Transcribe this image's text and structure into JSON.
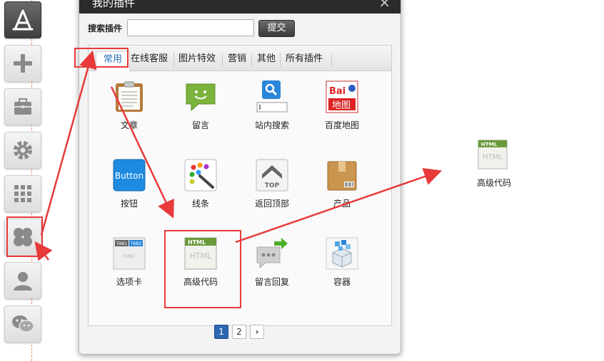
{
  "dialog": {
    "title": "我的插件",
    "close_glyph": "×",
    "search_label": "搜索插件",
    "search_value": "",
    "submit_label": "提交"
  },
  "tabs": [
    {
      "label": "常用",
      "active": true
    },
    {
      "label": "在线客服",
      "active": false
    },
    {
      "label": "图片特效",
      "active": false
    },
    {
      "label": "营销",
      "active": false
    },
    {
      "label": "其他",
      "active": false
    },
    {
      "label": "所有插件",
      "active": false
    }
  ],
  "plugins": [
    {
      "label": "文章",
      "icon": "clipboard-icon"
    },
    {
      "label": "留言",
      "icon": "chat-bubble-icon"
    },
    {
      "label": "站内搜索",
      "icon": "site-search-icon"
    },
    {
      "label": "百度地图",
      "icon": "baidu-map-icon"
    },
    {
      "label": "按钮",
      "icon": "button-icon",
      "icon_text": "Button"
    },
    {
      "label": "线条",
      "icon": "palette-icon"
    },
    {
      "label": "返回顶部",
      "icon": "back-to-top-icon",
      "icon_text": "TOP"
    },
    {
      "label": "产品",
      "icon": "product-box-icon"
    },
    {
      "label": "选项卡",
      "icon": "tabs-icon",
      "icon_text": [
        "TAB1",
        "TAB2",
        "FONT"
      ]
    },
    {
      "label": "高级代码",
      "icon": "html-code-icon",
      "icon_text": "HTML"
    },
    {
      "label": "留言回复",
      "icon": "message-reply-icon"
    },
    {
      "label": "容器",
      "icon": "container-icon"
    }
  ],
  "pagination": {
    "pages": [
      "1",
      "2"
    ],
    "current": "1",
    "next_glyph": "›"
  },
  "baidu_icon_text": {
    "top": "Bai",
    "bottom": "地图"
  },
  "result": {
    "label": "高级代码",
    "icon": "html-code-icon",
    "icon_text": "HTML"
  },
  "toolbar_icons": [
    "app-store-icon",
    "plus-icon",
    "toolbox-icon",
    "gear-icon",
    "grid-icon",
    "clover-icon",
    "user-icon",
    "wechat-icon"
  ],
  "colors": {
    "highlight": "#e83a3a",
    "accent": "#2a6fb7",
    "titlebar": "#2b2b2b"
  }
}
